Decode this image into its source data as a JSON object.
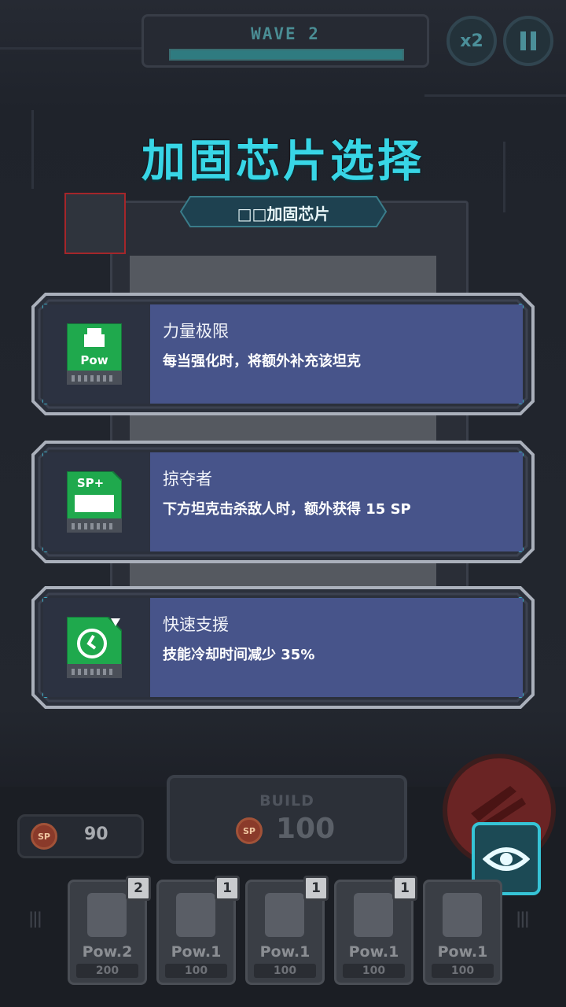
{
  "hud": {
    "wave_label": "WAVE 2",
    "wave_progress": 1.0,
    "speed_label": "x2",
    "pause_label": "II"
  },
  "modal": {
    "title": "加固芯片选择",
    "subtitle": "□□加固芯片",
    "options": [
      {
        "name": "力量极限",
        "description": "每当强化时，将额外补充该坦克",
        "chip_text": "Pow",
        "chip_icon": "tank-icon",
        "chip_color": "#1fa94d"
      },
      {
        "name": "掠夺者",
        "description": "下方坦克击杀敌人时，额外获得 15 SP",
        "chip_text": "SP+",
        "chip_icon": "sp-plus-icon",
        "chip_color": "#1fa94d"
      },
      {
        "name": "快速支援",
        "description": "技能冷却时间减少 35%",
        "chip_text": "",
        "chip_icon": "clock-icon",
        "chip_color": "#1fa94d"
      }
    ]
  },
  "bottom": {
    "build_label": "BUILD",
    "build_cost": "100",
    "sp_value": "90",
    "sp_coin": "SP",
    "units": [
      {
        "level": "Pow.2",
        "cost": "200",
        "count": "2"
      },
      {
        "level": "Pow.1",
        "cost": "100",
        "count": "1"
      },
      {
        "level": "Pow.1",
        "cost": "100",
        "count": "1"
      },
      {
        "level": "Pow.1",
        "cost": "100",
        "count": "1"
      },
      {
        "level": "Pow.1",
        "cost": "100",
        "count": ""
      }
    ]
  },
  "colors": {
    "accent": "#38d6e6",
    "card_bg": "#47548a",
    "chip_green": "#1fa94d"
  }
}
